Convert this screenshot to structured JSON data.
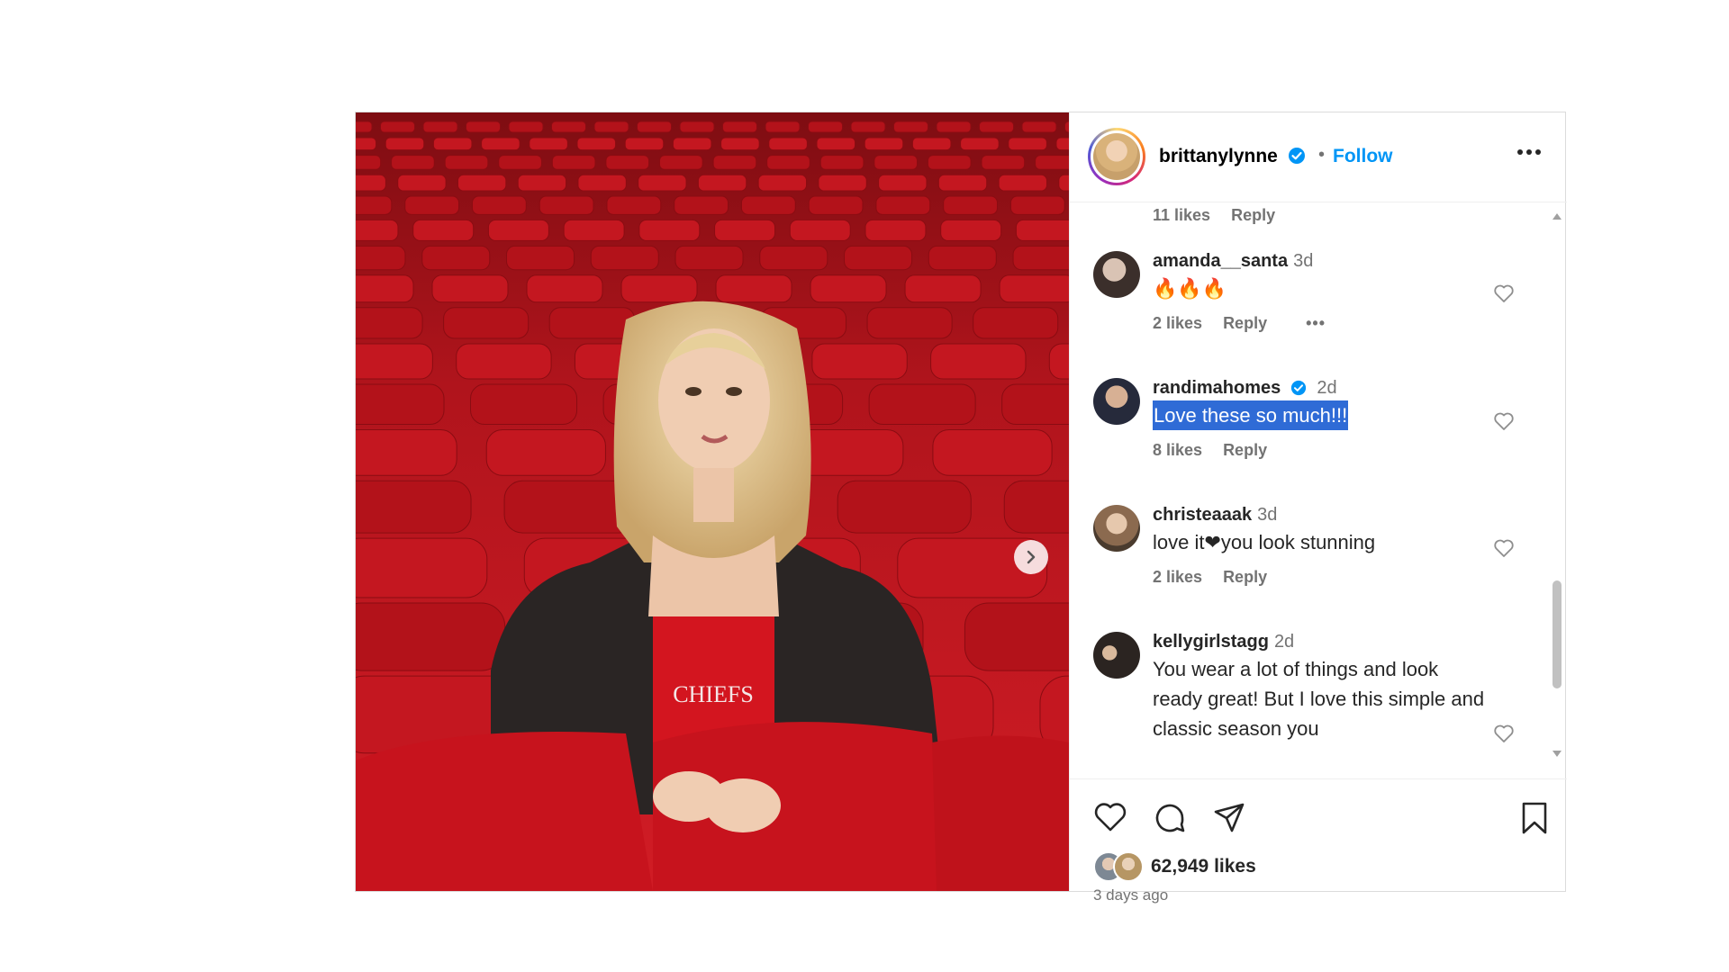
{
  "post": {
    "username": "brittanylynne",
    "separator": "•",
    "follow_label": "Follow",
    "more_label": "More options",
    "media_alt": "Photo of a woman in a black leather jacket seated among red stadium seats",
    "shirt_text": "CHIEFS"
  },
  "comments": {
    "prev_meta": {
      "likes": "11 likes",
      "reply": "Reply"
    },
    "items": [
      {
        "username": "amanda__santa",
        "time": "3d",
        "text": "🔥🔥🔥",
        "likes": "2 likes",
        "reply": "Reply",
        "more": "•••"
      },
      {
        "username": "randimahomes",
        "time": "2d",
        "text": "Love these so much!!!",
        "likes": "8 likes",
        "reply": "Reply"
      },
      {
        "username": "christeaaak",
        "time": "3d",
        "text": "love it❤you look stunning",
        "likes": "2 likes",
        "reply": "Reply"
      },
      {
        "username": "kellygirlstagg",
        "time": "2d",
        "text": "You wear a lot of things and look ready great! But I love this simple and classic season you",
        "likes": "",
        "reply": ""
      }
    ]
  },
  "actions": {
    "likes_count": "62,949 likes",
    "time_ago": "3 days ago"
  },
  "colors": {
    "accent": "#0095f6",
    "verified": "#0095f6",
    "selection": "#2f6bd6",
    "seat_red": "#c8141f"
  }
}
